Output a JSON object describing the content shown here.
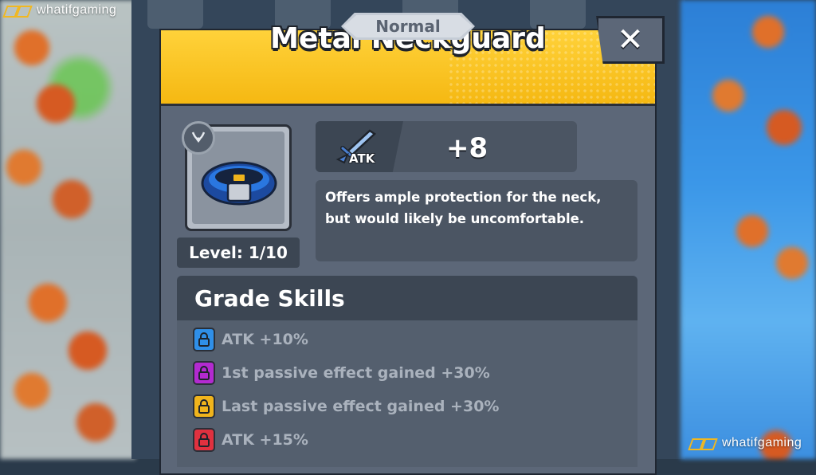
{
  "watermark": {
    "text": "whatifgaming"
  },
  "dialog": {
    "rarity": "Normal",
    "title": "Metal Neckguard",
    "close_label": "✕",
    "item": {
      "level_text": "Level: 1/10",
      "slot_icon": "necklace-slot-icon",
      "icon": "metal-neckguard-icon"
    },
    "stat": {
      "label": "ATK",
      "icon": "sword-icon",
      "value": "+8"
    },
    "description": {
      "line1": "Offers ample protection for the neck,",
      "line2": "but would likely be uncomfortable."
    },
    "grade_skills": {
      "title": "Grade Skills",
      "items": [
        {
          "text": "ATK +10%",
          "color": "#2f8fe8"
        },
        {
          "text": "1st passive effect gained +30%",
          "color": "#b32ad0"
        },
        {
          "text": "Last passive effect gained +30%",
          "color": "#f0b41c"
        },
        {
          "text": "ATK +15%",
          "color": "#e0313f"
        }
      ]
    }
  },
  "colors": {
    "header_yellow": "#f8c41c",
    "panel_gray": "#5c6778",
    "dark_panel": "#3c4653"
  }
}
